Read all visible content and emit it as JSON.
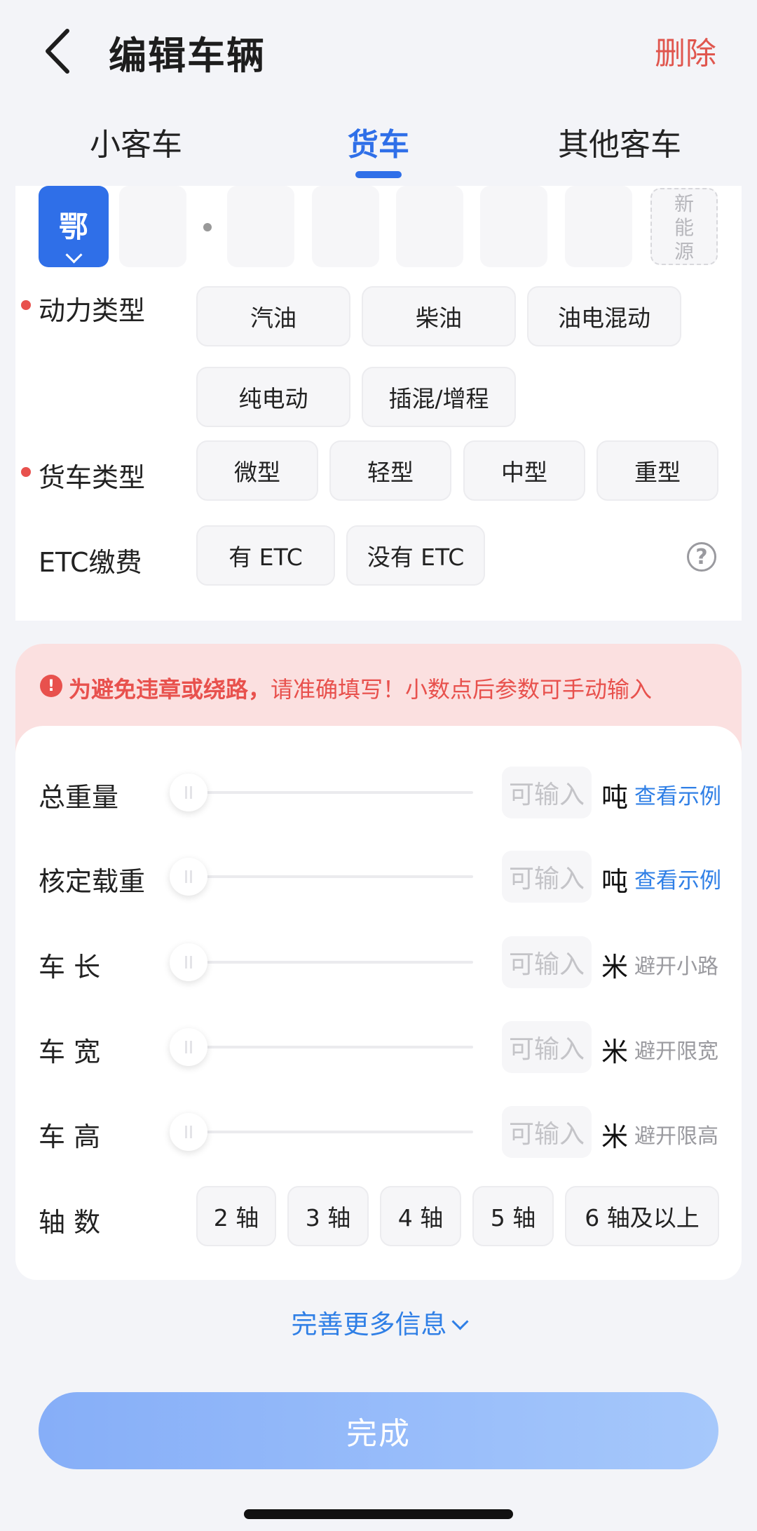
{
  "header": {
    "title": "编辑车辆",
    "delete_label": "删除"
  },
  "tabs": [
    {
      "label": "小客车",
      "active": false
    },
    {
      "label": "货车",
      "active": true
    },
    {
      "label": "其他客车",
      "active": false
    }
  ],
  "plate": {
    "province": "鄂",
    "new_energy": "新能源"
  },
  "power_type": {
    "label": "动力类型",
    "options": [
      "汽油",
      "柴油",
      "油电混动",
      "纯电动",
      "插混/增程"
    ]
  },
  "truck_type": {
    "label": "货车类型",
    "options": [
      "微型",
      "轻型",
      "中型",
      "重型"
    ]
  },
  "etc": {
    "label": "ETC缴费",
    "options": [
      "有 ETC",
      "没有 ETC"
    ],
    "help": "?"
  },
  "warning": {
    "icon": "!",
    "strong": "为避免违章或绕路，",
    "rest": "请准确填写！小数点后参数可手动输入"
  },
  "params": [
    {
      "label": "总重量",
      "placeholder": "可输入",
      "unit": "吨",
      "extra": "查看示例",
      "extra_type": "link",
      "value": 0
    },
    {
      "label": "核定载重",
      "placeholder": "可输入",
      "unit": "吨",
      "extra": "查看示例",
      "extra_type": "link",
      "value": 0
    },
    {
      "label": "车 长",
      "placeholder": "可输入",
      "unit": "米",
      "extra": "避开小路",
      "extra_type": "hint",
      "value": 0
    },
    {
      "label": "车 宽",
      "placeholder": "可输入",
      "unit": "米",
      "extra": "避开限宽",
      "extra_type": "hint",
      "value": 0
    },
    {
      "label": "车 高",
      "placeholder": "可输入",
      "unit": "米",
      "extra": "避开限高",
      "extra_type": "hint",
      "value": 0
    }
  ],
  "axles": {
    "label": "轴 数",
    "options": [
      "2 轴",
      "3 轴",
      "4 轴",
      "5 轴",
      "6 轴及以上"
    ]
  },
  "more_info": "完善更多信息",
  "done_label": "完成",
  "colors": {
    "accent": "#2f6fe8",
    "danger": "#e8514d",
    "link": "#2f7fe6"
  }
}
